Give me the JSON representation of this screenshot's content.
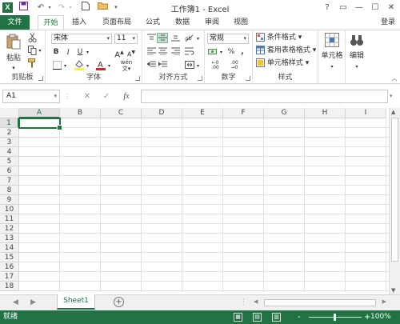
{
  "titlebar": {
    "app_icon": "X",
    "title": "工作簿1 - Excel",
    "help": "?",
    "restore_ribbon": "▭",
    "minimize": "—",
    "maximize": "☐",
    "close": "✕"
  },
  "qat": {
    "save_icon": "save-icon",
    "undo_icon": "undo-icon",
    "redo_icon": "redo-icon",
    "new_icon": "new-file-icon",
    "open_icon": "folder-icon"
  },
  "tabs": [
    {
      "label": "文件"
    },
    {
      "label": "开始"
    },
    {
      "label": "插入"
    },
    {
      "label": "页面布局"
    },
    {
      "label": "公式"
    },
    {
      "label": "数据"
    },
    {
      "label": "审阅"
    },
    {
      "label": "视图"
    }
  ],
  "login": "登录",
  "ribbon": {
    "clipboard": {
      "label": "剪贴板",
      "paste": "粘贴"
    },
    "font": {
      "label": "字体",
      "name": "宋体",
      "size": "11",
      "bold": "B",
      "italic": "I",
      "underline": "U",
      "grow": "A",
      "shrink": "A",
      "phonetic": "wén"
    },
    "alignment": {
      "label": "对齐方式"
    },
    "number": {
      "label": "数字",
      "format": "常规",
      "percent": "%",
      "comma": ","
    },
    "styles": {
      "label": "样式",
      "conditional": "条件格式",
      "table": "套用表格格式",
      "cell": "单元格样式"
    },
    "cells": {
      "label": "单元格"
    },
    "editing": {
      "label": "编辑"
    }
  },
  "formula": {
    "namebox": "A1",
    "cancel": "✕",
    "enter": "✓",
    "fx": "fx",
    "value": ""
  },
  "columns": [
    "A",
    "B",
    "C",
    "D",
    "E",
    "F",
    "G",
    "H",
    "I"
  ],
  "rows": [
    "1",
    "2",
    "3",
    "4",
    "5",
    "6",
    "7",
    "8",
    "9",
    "10",
    "11",
    "12",
    "13",
    "14",
    "15",
    "16",
    "17",
    "18"
  ],
  "sheets": {
    "active": "Sheet1",
    "add": "+"
  },
  "status": {
    "ready": "就绪",
    "zoom": "100%",
    "zoom_minus": "-",
    "zoom_plus": "+"
  },
  "accent": "#217346"
}
